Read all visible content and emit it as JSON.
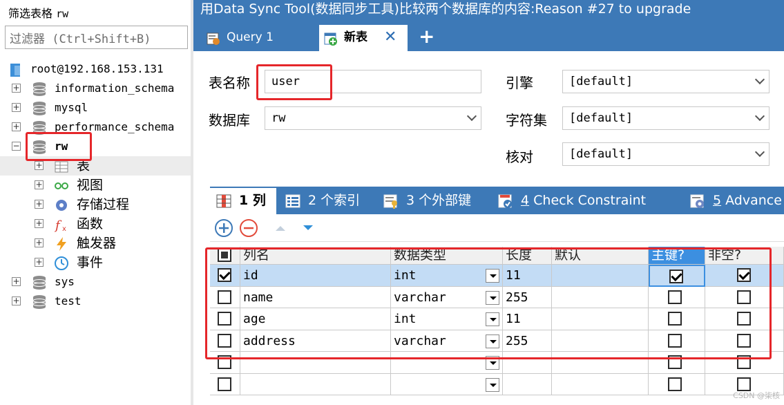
{
  "left_panel": {
    "title_prefix": "筛选表格",
    "title_db": "rw",
    "filter_placeholder": "过滤器 (Ctrl+Shift+B)",
    "connection": "root@192.168.153.131",
    "databases": [
      {
        "name": "information_schema",
        "expanded": false
      },
      {
        "name": "mysql",
        "expanded": false
      },
      {
        "name": "performance_schema",
        "expanded": false
      },
      {
        "name": "rw",
        "expanded": true
      },
      {
        "name": "sys",
        "expanded": false
      },
      {
        "name": "test",
        "expanded": false
      }
    ],
    "rw_children": [
      {
        "label": "表",
        "icon": "table-icon"
      },
      {
        "label": "视图",
        "icon": "view-icon"
      },
      {
        "label": "存储过程",
        "icon": "gear-icon"
      },
      {
        "label": "函数",
        "icon": "function-icon"
      },
      {
        "label": "触发器",
        "icon": "lightning-icon"
      },
      {
        "label": "事件",
        "icon": "clock-icon"
      }
    ]
  },
  "right_panel": {
    "title": "用Data Sync Tool(数据同步工具)比较两个数据库的内容:Reason #27 to upgrade",
    "tabs": [
      {
        "label": "Query 1",
        "active": false
      },
      {
        "label": "新表",
        "active": true
      }
    ],
    "close_symbol": "✕",
    "add_symbol": "+",
    "form": {
      "table_name_label": "表名称",
      "table_name_value": "user",
      "database_label": "数据库",
      "database_value": "rw",
      "engine_label": "引擎",
      "engine_value": "[default]",
      "charset_label": "字符集",
      "charset_value": "[default]",
      "collation_label": "核对",
      "collation_value": "[default]"
    },
    "subtabs": [
      {
        "num": "1",
        "label": "列",
        "active": true
      },
      {
        "num": "2",
        "label": "个索引",
        "active": false
      },
      {
        "num": "3",
        "label": "个外部键",
        "active": false
      },
      {
        "num": "4",
        "label": "Check Constraint",
        "active": false
      },
      {
        "num": "5",
        "label": "Advance",
        "active": false
      }
    ],
    "grid": {
      "headers": [
        "列名",
        "数据类型",
        "长度",
        "默认",
        "主键?",
        "非空?"
      ],
      "rows": [
        {
          "checked": true,
          "name": "id",
          "type": "int",
          "length": "11",
          "default": "",
          "pk": true,
          "nn": true
        },
        {
          "checked": false,
          "name": "name",
          "type": "varchar",
          "length": "255",
          "default": "",
          "pk": false,
          "nn": false
        },
        {
          "checked": false,
          "name": "age",
          "type": "int",
          "length": "11",
          "default": "",
          "pk": false,
          "nn": false
        },
        {
          "checked": false,
          "name": "address",
          "type": "varchar",
          "length": "255",
          "default": "",
          "pk": false,
          "nn": false
        },
        {
          "checked": false,
          "name": "",
          "type": "",
          "length": "",
          "default": "",
          "pk": false,
          "nn": false
        },
        {
          "checked": false,
          "name": "",
          "type": "",
          "length": "",
          "default": "",
          "pk": false,
          "nn": false
        }
      ]
    }
  },
  "watermark": "CSDN @柒核",
  "colors": {
    "accent_blue": "#3d79b7",
    "selected_row": "#c3dcf5",
    "highlight_header": "#3c8fe0",
    "annotation_red": "#e5262a"
  }
}
